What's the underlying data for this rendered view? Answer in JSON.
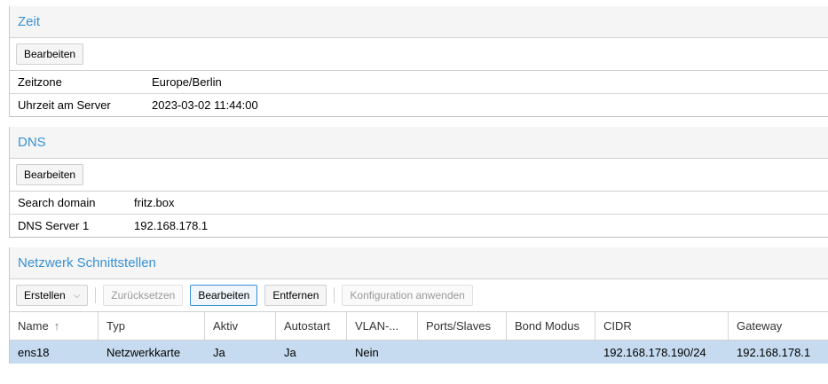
{
  "zeit": {
    "title": "Zeit",
    "edit_label": "Bearbeiten",
    "rows": [
      {
        "key": "Zeitzone",
        "value": "Europe/Berlin"
      },
      {
        "key": "Uhrzeit am Server",
        "value": "2023-03-02 11:44:00"
      }
    ]
  },
  "dns": {
    "title": "DNS",
    "edit_label": "Bearbeiten",
    "rows": [
      {
        "key": "Search domain",
        "value": "fritz.box"
      },
      {
        "key": "DNS Server 1",
        "value": "192.168.178.1"
      }
    ]
  },
  "network": {
    "title": "Netzwerk Schnittstellen",
    "toolbar": {
      "create_label": "Erstellen",
      "reset_label": "Zurücksetzen",
      "edit_label": "Bearbeiten",
      "remove_label": "Entfernen",
      "apply_label": "Konfiguration anwenden"
    },
    "columns": [
      "Name",
      "Typ",
      "Aktiv",
      "Autostart",
      "VLAN-...",
      "Ports/Slaves",
      "Bond Modus",
      "CIDR",
      "Gateway"
    ],
    "rows": [
      {
        "name": "ens18",
        "typ": "Netzwerkkarte",
        "aktiv": "Ja",
        "autostart": "Ja",
        "vlan": "Nein",
        "ports": "",
        "bond": "",
        "cidr": "192.168.178.190/24",
        "gateway": "192.168.178.1"
      }
    ]
  }
}
